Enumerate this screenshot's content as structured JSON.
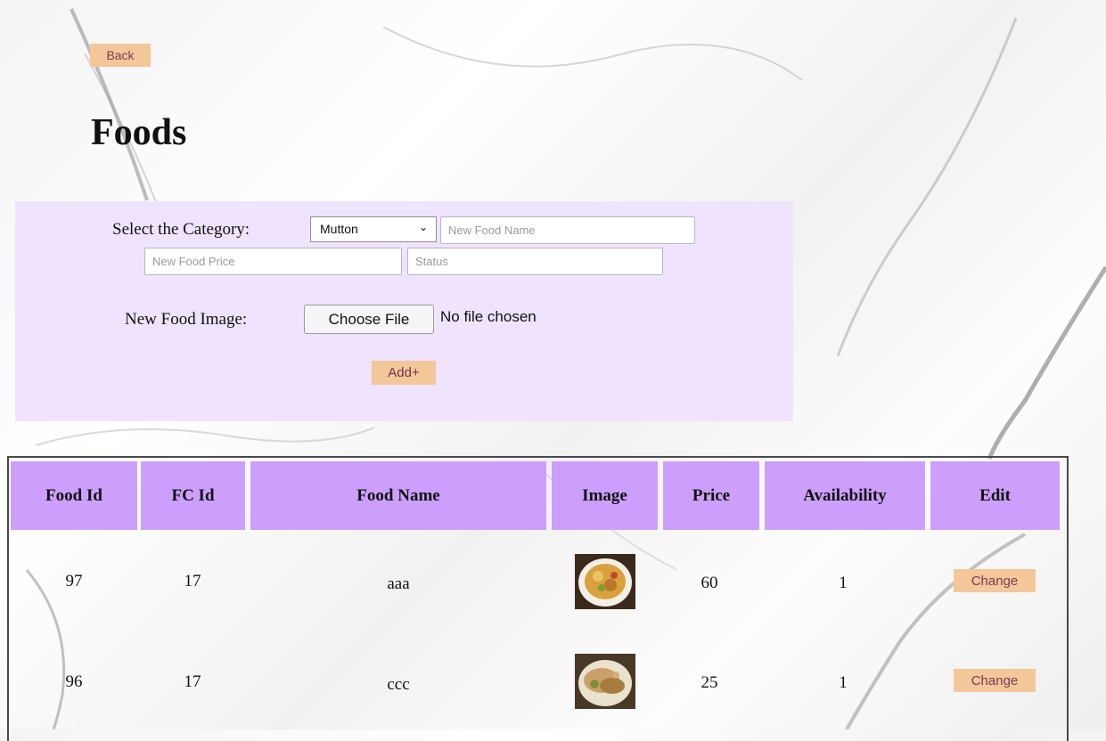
{
  "nav": {
    "back_label": "Back"
  },
  "page": {
    "title": "Foods"
  },
  "form": {
    "category_label": "Select the Category:",
    "category_selected": "Mutton",
    "name_placeholder": "New Food Name",
    "price_placeholder": "New Food Price",
    "status_placeholder": "Status",
    "image_label": "New Food Image:",
    "file_button_label": "Choose File",
    "file_status": "No file chosen",
    "add_label": "Add+"
  },
  "table": {
    "headers": [
      "Food Id",
      "FC Id",
      "Food Name",
      "Image",
      "Price",
      "Availability",
      "Edit"
    ],
    "rows": [
      {
        "food_id": "97",
        "fc_id": "17",
        "food_name": "aaa",
        "image": "food-thumbnail",
        "price": "60",
        "availability": "1",
        "edit_label": "Change"
      },
      {
        "food_id": "96",
        "fc_id": "17",
        "food_name": "ccc",
        "image": "food-thumbnail",
        "price": "25",
        "availability": "1",
        "edit_label": "Change"
      }
    ]
  },
  "colors": {
    "button": "#f3c79a",
    "panel": "#f0e3fd",
    "table_header": "#cd9ffc"
  }
}
